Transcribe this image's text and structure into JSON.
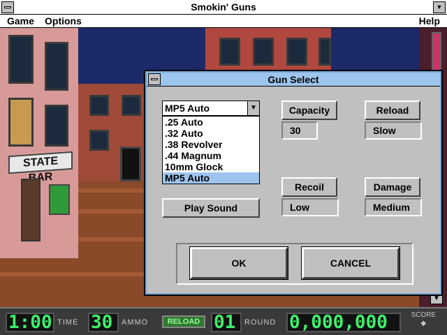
{
  "window": {
    "title": "Smokin' Guns"
  },
  "menu": {
    "game": "Game",
    "options": "Options",
    "help": "Help"
  },
  "scene": {
    "sign": "STATE BAR"
  },
  "dialog": {
    "title": "Gun Select",
    "selected_gun": "MP5 Auto",
    "gun_options": [
      ".25 Auto",
      ".32 Auto",
      ".38 Revolver",
      ".44 Magnum",
      "10mm Glock",
      "MP5 Auto"
    ],
    "play_sound_label": "Play Sound",
    "capacity_label": "Capacity",
    "capacity_value": "30",
    "reload_label": "Reload",
    "reload_value": "Slow",
    "recoil_label": "Recoil",
    "recoil_value": "Low",
    "damage_label": "Damage",
    "damage_value": "Medium",
    "ok_label": "OK",
    "cancel_label": "CANCEL"
  },
  "hud": {
    "time": "1:00",
    "time_label": "TIME",
    "ammo": "30",
    "ammo_label": "AMMO",
    "reload_label": "RELOAD",
    "round": "01",
    "round_label": "ROUND",
    "score": "0,000,000",
    "score_label": "SCORE"
  },
  "colors": {
    "dialog_title": "#9cc4ec",
    "lcd_digits": "#3cf06c",
    "selection": "#9cc4ec"
  }
}
